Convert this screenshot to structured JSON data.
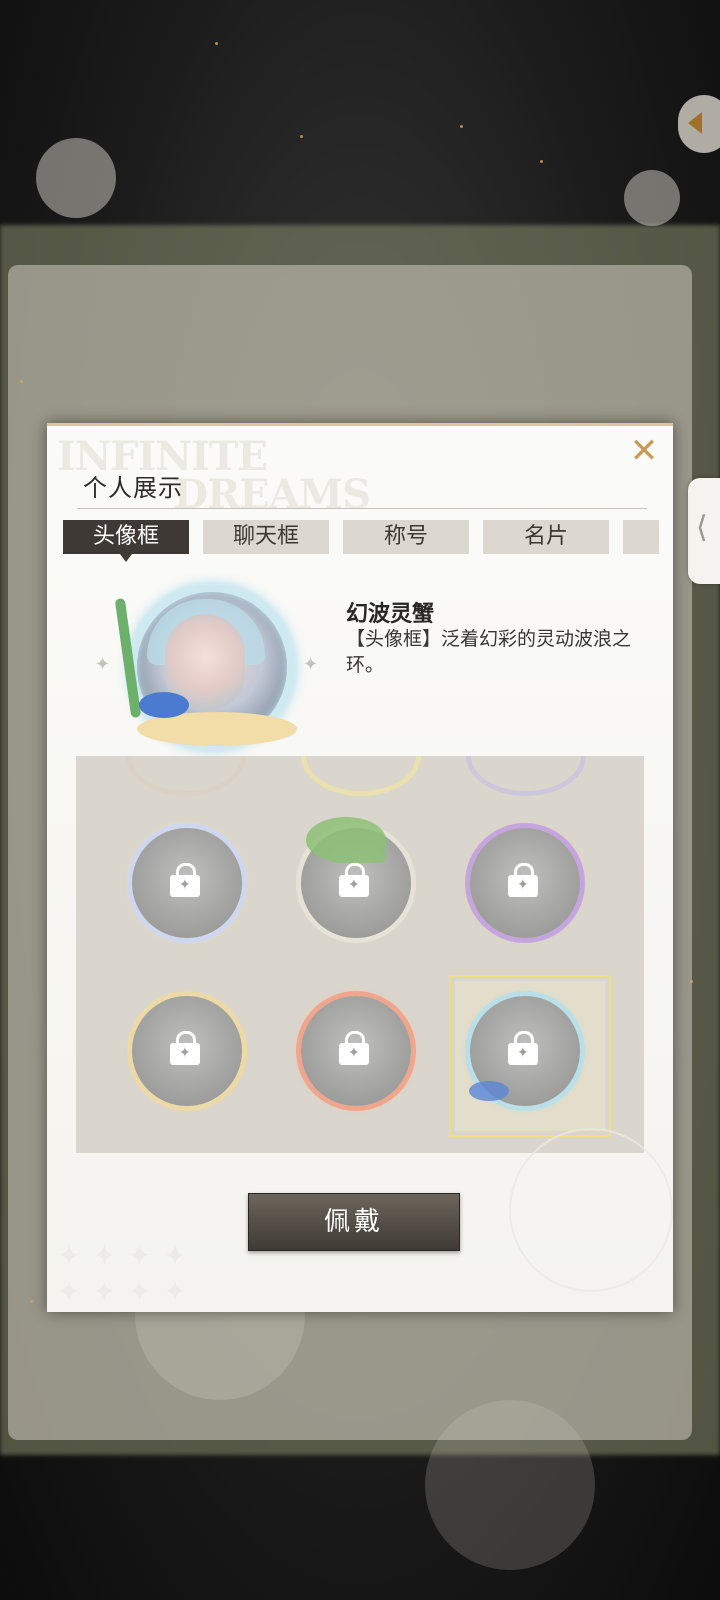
{
  "modal": {
    "watermark": "INFINITE\nDREAMS",
    "title": "个人展示",
    "close_symbol": "✕",
    "tabs": [
      {
        "label": "头像框",
        "active": true
      },
      {
        "label": "聊天框",
        "active": false
      },
      {
        "label": "称号",
        "active": false
      },
      {
        "label": "名片",
        "active": false
      },
      {
        "label": "",
        "active": false
      }
    ],
    "selected_item": {
      "name": "幻波灵蟹",
      "description": "【头像框】泛着幻彩的灵动波浪之环。"
    },
    "grid_items": [
      {
        "icon": "lock-icon",
        "selected": false
      },
      {
        "icon": "lock-icon",
        "selected": false
      },
      {
        "icon": "lock-icon",
        "selected": false
      },
      {
        "icon": "lock-icon",
        "selected": false
      },
      {
        "icon": "lock-icon",
        "selected": false
      },
      {
        "icon": "lock-icon",
        "selected": true
      }
    ],
    "wear_button": "佩戴"
  },
  "colors": {
    "accent": "#c79a56",
    "tab_active_bg": "#3e3934",
    "selection": "#f2dd84"
  }
}
